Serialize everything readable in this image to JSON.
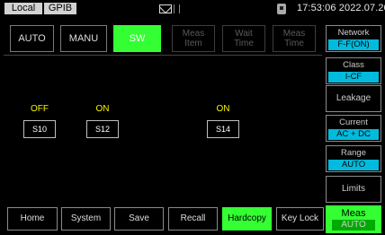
{
  "status": {
    "local": "Local",
    "gpib": "GPIB",
    "datetime": "17:53:06 2022.07.20"
  },
  "mode_buttons": {
    "auto": "AUTO",
    "manu": "MANU",
    "sw": "SW",
    "meas_item": [
      "Meas",
      "Item"
    ],
    "wait_time": [
      "Wait",
      "Time"
    ],
    "meas_time": [
      "Meas",
      "Time"
    ]
  },
  "channels": [
    {
      "state": "OFF",
      "name": "S10"
    },
    {
      "state": "ON",
      "name": "S12"
    },
    {
      "state": "ON",
      "name": "S14"
    }
  ],
  "side_keys": {
    "network": {
      "label": "Network",
      "value": "F-F(ON)"
    },
    "class": {
      "label": "Class",
      "value": "I-CF"
    },
    "leakage": {
      "label": "Leakage"
    },
    "current": {
      "label": "Current",
      "value": "AC + DC"
    },
    "range": {
      "label": "Range",
      "value": "AUTO"
    },
    "limits": {
      "label": "Limits"
    },
    "meas": {
      "label": "Meas",
      "value": "AUTO"
    }
  },
  "bottom_keys": {
    "home": "Home",
    "system": "System",
    "save": "Save",
    "recall": "Recall",
    "hardcopy": "Hardcopy",
    "keylock": "Key Lock"
  },
  "colors": {
    "active_green": "#33ff33",
    "value_cyan": "#00bbdd",
    "state_yellow": "#f5f500"
  }
}
